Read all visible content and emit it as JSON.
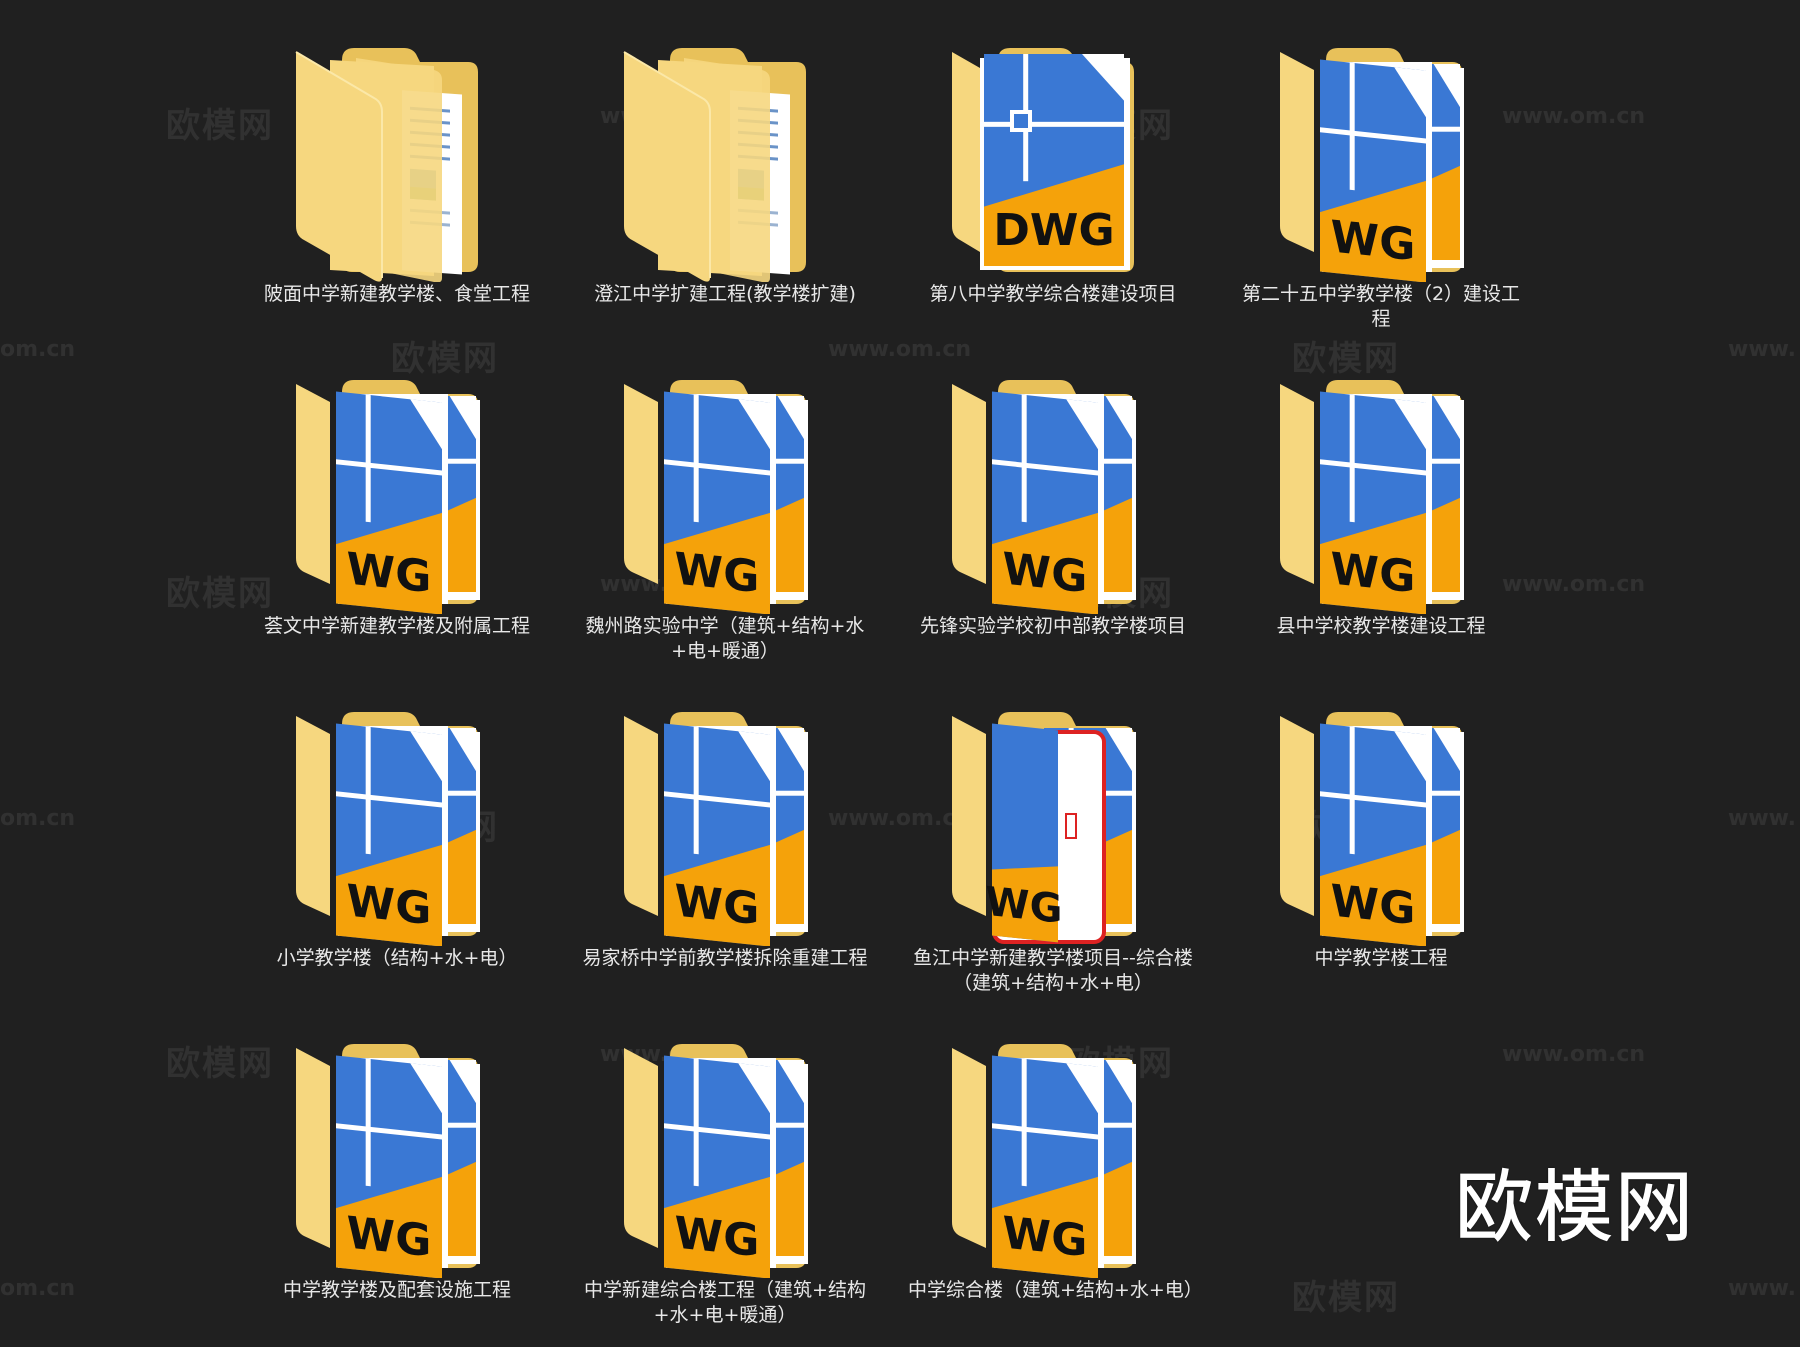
{
  "folders": [
    {
      "label": "陂面中学新建教学楼、食堂工程",
      "kind": "docs"
    },
    {
      "label": "澄江中学扩建工程(教学楼扩建)",
      "kind": "docs"
    },
    {
      "label": "第八中学教学综合楼建设项目",
      "kind": "dwg-single"
    },
    {
      "label": "第二十五中学教学楼（2）建设工程",
      "kind": "dwg"
    },
    {
      "label": "荟文中学新建教学楼及附属工程",
      "kind": "dwg"
    },
    {
      "label": "魏州路实验中学（建筑+结构+水+电+暖通）",
      "kind": "dwg"
    },
    {
      "label": "先锋实验学校初中部教学楼项目",
      "kind": "dwg"
    },
    {
      "label": "县中学校教学楼建设工程",
      "kind": "dwg"
    },
    {
      "label": "小学教学楼（结构+水+电）",
      "kind": "dwg"
    },
    {
      "label": "易家桥中学前教学楼拆除重建工程",
      "kind": "dwg"
    },
    {
      "label": "鱼江中学新建教学楼项目--综合楼（建筑+结构+水+电）",
      "kind": "dwg-pdf"
    },
    {
      "label": "中学教学楼工程",
      "kind": "dwg"
    },
    {
      "label": "中学教学楼及配套设施工程",
      "kind": "dwg"
    },
    {
      "label": "中学新建综合楼工程（建筑+结构+水+电+暖通）",
      "kind": "dwg"
    },
    {
      "label": "中学综合楼（建筑+结构+水+电）",
      "kind": "dwg"
    }
  ],
  "icon_text": {
    "dwg_full": "DWG",
    "dwg_partial": "WG",
    "g": "G"
  },
  "watermark": {
    "cn": "欧模网",
    "url": "www.om.cn",
    "url_partial": "om.cn",
    "url_left": "www."
  },
  "brand": "欧模网",
  "colors": {
    "background": "#202020",
    "folder_back": "#e8c15a",
    "folder_front": "#f6d77f",
    "dwg_blue": "#3a78d4",
    "dwg_orange": "#f5a20a"
  }
}
